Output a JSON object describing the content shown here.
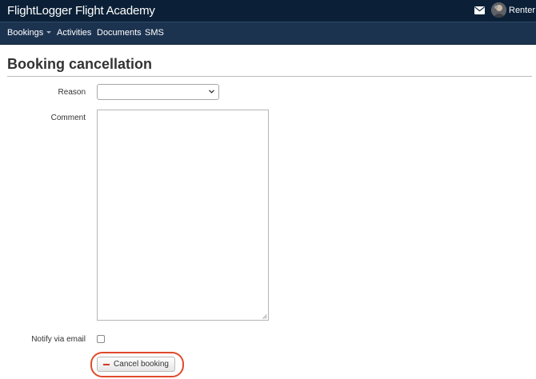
{
  "header": {
    "brand": "FlightLogger Flight Academy",
    "user_name": "Renter",
    "icons": [
      "envelope-icon",
      "avatar"
    ]
  },
  "nav": {
    "items": [
      {
        "label": "Bookings",
        "has_dropdown": true
      },
      {
        "label": "Activities"
      },
      {
        "label": "Documents"
      },
      {
        "label": "SMS"
      }
    ]
  },
  "page": {
    "title": "Booking cancellation"
  },
  "form": {
    "reason_label": "Reason",
    "reason_value": "",
    "comment_label": "Comment",
    "comment_value": "",
    "notify_label": "Notify via email",
    "notify_checked": false,
    "submit_label": "Cancel booking",
    "submit_icon": "minus-icon"
  },
  "colors": {
    "topbar": "#0b2037",
    "navbar": "#1c3350",
    "highlight": "#e04a2c",
    "minus": "#d6362a"
  }
}
